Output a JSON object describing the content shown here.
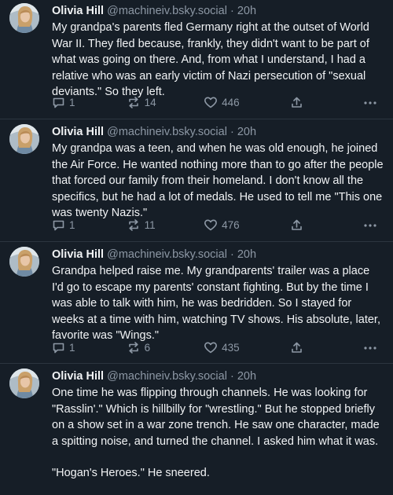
{
  "posts": [
    {
      "author": "Olivia Hill",
      "handle": "@machineiv.bsky.social",
      "time": "20h",
      "paragraphs": [
        "My grandpa's parents fled Germany right at the outset of World War II. They fled because, frankly, they didn't want to be part of what was going on there. And, from what I understand, I had a relative who was an early victim of Nazi persecution of \"sexual deviants.\" So they left."
      ],
      "replies": "1",
      "reposts": "14",
      "likes": "446"
    },
    {
      "author": "Olivia Hill",
      "handle": "@machineiv.bsky.social",
      "time": "20h",
      "paragraphs": [
        "My grandpa was a teen, and when he was old enough, he joined the Air Force. He wanted nothing more than to go after the people that forced our family from their homeland. I don't know all the specifics, but he had a lot of medals. He used to tell me \"This one was twenty Nazis.\""
      ],
      "replies": "1",
      "reposts": "11",
      "likes": "476"
    },
    {
      "author": "Olivia Hill",
      "handle": "@machineiv.bsky.social",
      "time": "20h",
      "paragraphs": [
        "Grandpa helped raise me. My grandparents' trailer was a place I'd go to escape my parents' constant fighting. But by the time I was able to talk with him, he was bedridden. So I stayed for weeks at a time with him, watching TV shows. His absolute, later, favorite was \"Wings.\""
      ],
      "replies": "1",
      "reposts": "6",
      "likes": "435"
    },
    {
      "author": "Olivia Hill",
      "handle": "@machineiv.bsky.social",
      "time": "20h",
      "paragraphs": [
        "One time he was flipping through channels. He was looking for \"Rasslin'.\" Which is hillbilly for \"wrestling.\" But he stopped briefly on a show set in a war zone trench. He saw one character, made a spitting noise, and turned the channel. I asked him what it was.",
        "\"Hogan's Heroes.\" He sneered."
      ]
    }
  ],
  "separator": "·",
  "icons": {
    "reply": "reply-bubble-icon",
    "repost": "repost-arrows-icon",
    "like": "heart-icon",
    "share": "share-upload-icon",
    "more": "more-dots-icon"
  },
  "colors": {
    "background": "#161e27",
    "text": "#f1f3f5",
    "muted": "#8d98a5",
    "divider": "#2c3640"
  }
}
